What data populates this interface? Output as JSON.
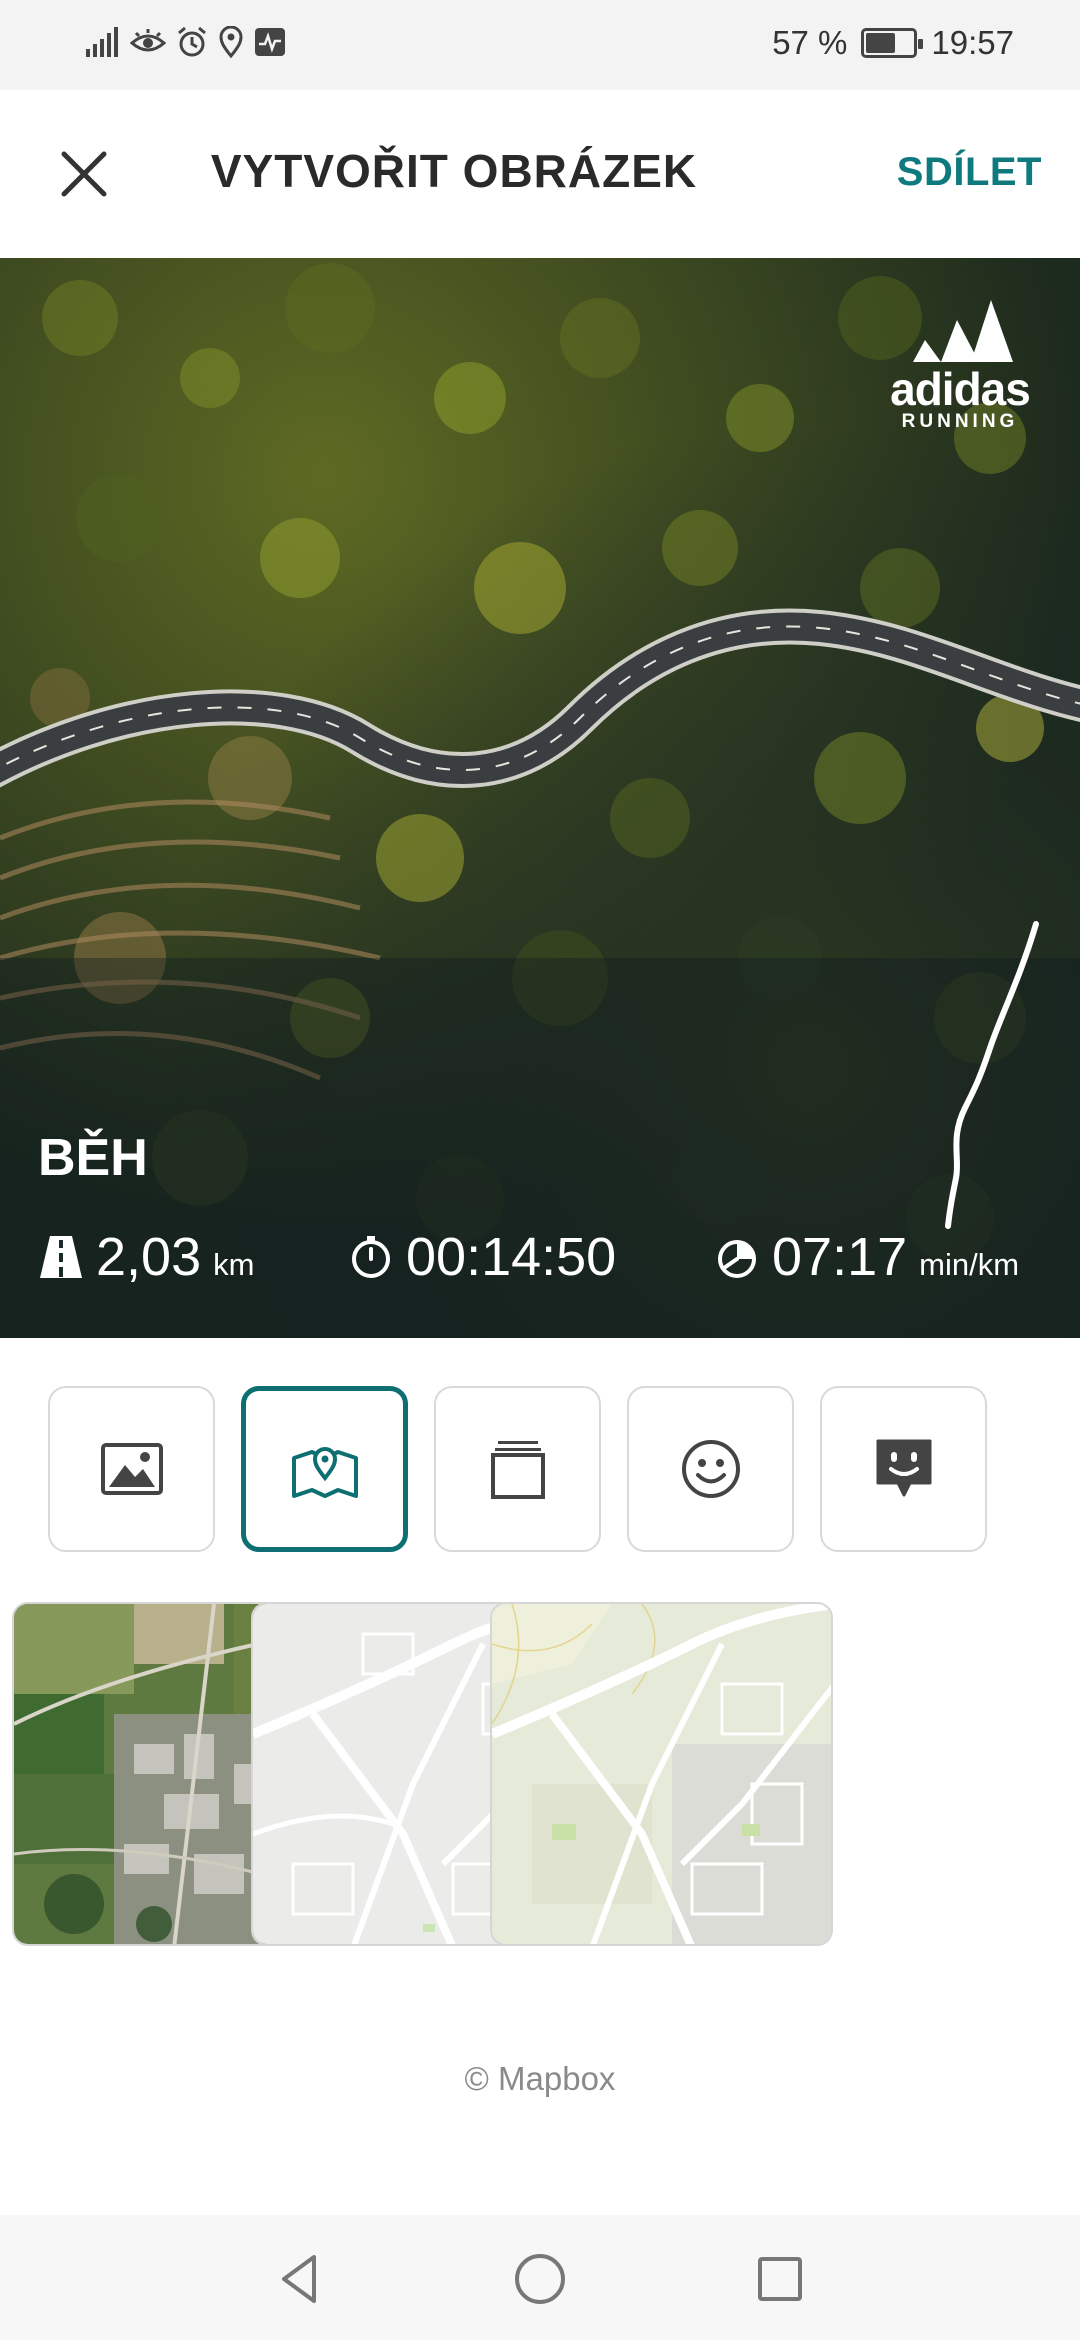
{
  "status_bar": {
    "battery_text": "57 %",
    "battery_level": 0.57,
    "time": "19:57",
    "icons": [
      "signal-icon",
      "eye-icon",
      "alarm-icon",
      "location-icon",
      "activity-icon"
    ]
  },
  "header": {
    "title": "VYTVOŘIT OBRÁZEK",
    "share_label": "SDÍLET",
    "close_icon": "close-icon"
  },
  "preview": {
    "brand_word": "adidas",
    "brand_sub": "RUNNING",
    "activity_title": "BĚH",
    "stats": {
      "distance_value": "2,03",
      "distance_unit": "km",
      "duration_value": "00:14:50",
      "pace_value": "07:17",
      "pace_unit": "min/km"
    }
  },
  "tools": [
    {
      "name": "image-icon",
      "active": false
    },
    {
      "name": "map-icon",
      "active": true
    },
    {
      "name": "layers-icon",
      "active": false
    },
    {
      "name": "smiley-icon",
      "active": false
    },
    {
      "name": "sticker-icon",
      "active": false
    }
  ],
  "map_styles": [
    "satellite",
    "light",
    "outdoors"
  ],
  "attribution": "© Mapbox",
  "colors": {
    "accent": "#0e7a7e",
    "active_border": "#0e6f72"
  }
}
